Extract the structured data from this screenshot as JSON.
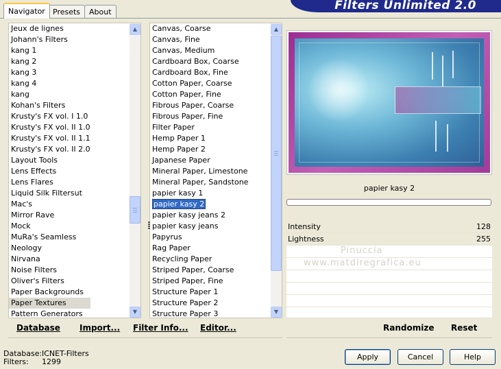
{
  "tabs": [
    "Navigator",
    "Presets",
    "About"
  ],
  "banner_title": "Filters Unlimited 2.0",
  "categories": [
    "Jeux de lignes",
    "Johann's Filters",
    "kang 1",
    "kang 2",
    "kang 3",
    "kang 4",
    "kang",
    "Kohan's Filters",
    "Krusty's FX vol. I 1.0",
    "Krusty's FX vol. II 1.0",
    "Krusty's FX vol. II 1.1",
    "Krusty's FX vol. II 2.0",
    "Layout Tools",
    "Lens Effects",
    "Lens Flares",
    "Liquid Silk Filtersut",
    "Mac's",
    "Mirror Rave",
    "Mock",
    "MuRa's Seamless",
    "Neology",
    "Nirvana",
    "Noise Filters",
    "Oliver's Filters",
    "Paper Backgrounds",
    "Paper Textures",
    "Pattern Generators"
  ],
  "selected_category": "Paper Textures",
  "filters": [
    "Canvas, Coarse",
    "Canvas, Fine",
    "Canvas, Medium",
    "Cardboard Box, Coarse",
    "Cardboard Box, Fine",
    "Cotton Paper, Coarse",
    "Cotton Paper, Fine",
    "Fibrous Paper, Coarse",
    "Fibrous Paper, Fine",
    "Filter Paper",
    "Hemp Paper 1",
    "Hemp Paper 2",
    "Japanese Paper",
    "Mineral Paper, Limestone",
    "Mineral Paper, Sandstone",
    "papier kasy 1",
    "papier kasy 2",
    "papier kasy jeans 2",
    "papier kasy jeans",
    "Papyrus",
    "Rag Paper",
    "Recycling Paper",
    "Striped Paper, Coarse",
    "Striped Paper, Fine",
    "Structure Paper 1",
    "Structure Paper 2",
    "Structure Paper 3"
  ],
  "selected_filter": "papier kasy 2",
  "current_filter_name": "papier kasy 2",
  "params": [
    {
      "label": "Intensity",
      "value": "128"
    },
    {
      "label": "Lightness",
      "value": "255"
    }
  ],
  "watermark": [
    "Pinuccia",
    "www.matdiregrafica.eu"
  ],
  "links": {
    "database": "Database",
    "import": "Import...",
    "filter_info": "Filter Info...",
    "editor": "Editor...",
    "randomize": "Randomize",
    "reset": "Reset"
  },
  "status": {
    "database_label": "Database:",
    "database_value": "ICNET-Filters",
    "filters_label": "Filters:",
    "filters_value": "1299"
  },
  "buttons": {
    "apply": "Apply",
    "cancel": "Cancel",
    "help": "Help"
  },
  "colors": {
    "banner": "#1f2a8c",
    "selection": "#316ac5",
    "frame": "#a23b9a"
  }
}
